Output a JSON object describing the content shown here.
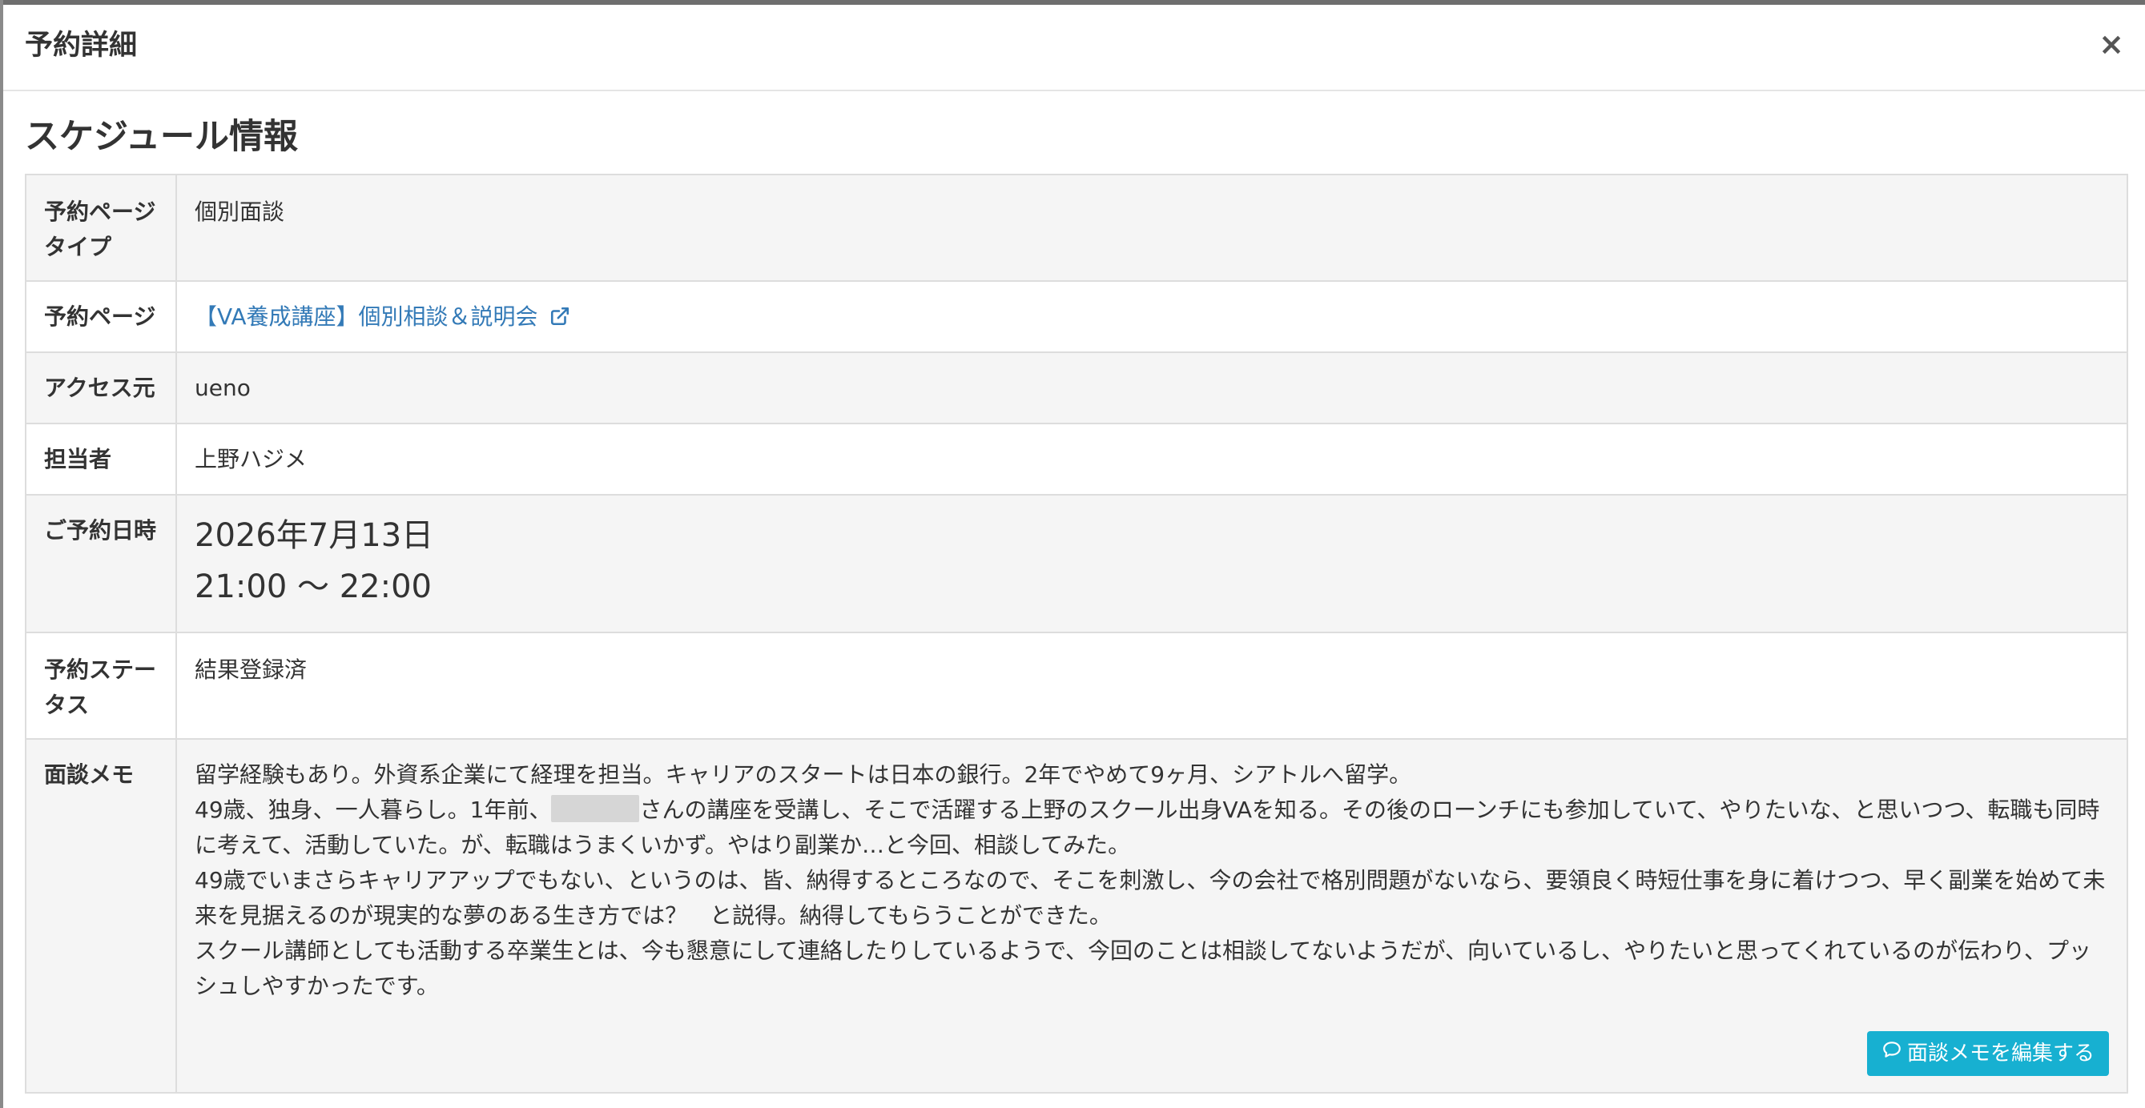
{
  "modal": {
    "title": "予約詳細",
    "close_label": "×"
  },
  "section_title": "スケジュール情報",
  "rows": {
    "page_type": {
      "label": "予約ページタイプ",
      "value": "個別面談"
    },
    "page": {
      "label": "予約ページ",
      "value": "【VA養成講座】個別相談＆説明会"
    },
    "access": {
      "label": "アクセス元",
      "value": "ueno"
    },
    "staff": {
      "label": "担当者",
      "value": "上野ハジメ"
    },
    "datetime": {
      "label": "ご予約日時",
      "date": "2026年7月13日",
      "time": "21:00 〜 22:00"
    },
    "status": {
      "label": "予約ステータス",
      "value": "結果登録済"
    },
    "memo": {
      "label": "面談メモ",
      "line1": "留学経験もあり。外資系企業にて経理を担当。キャリアのスタートは日本の銀行。2年でやめて9ヶ月、シアトルへ留学。",
      "line2_pre": "49歳、独身、一人暮らし。1年前、",
      "line2_post": "さんの講座を受講し、そこで活躍する上野のスクール出身VAを知る。その後のローンチにも参加していて、やりたいな、と思いつつ、転職も同時に考えて、活動していた。が、転職はうまくいかず。やはり副業か…と今回、相談してみた。",
      "line3": "49歳でいまさらキャリアアップでもない、というのは、皆、納得するところなので、そこを刺激し、今の会社で格別問題がないなら、要領良く時短仕事を身に着けつつ、早く副業を始めて未来を見据えるのが現実的な夢のある生き方では？　と説得。納得してもらうことができた。",
      "line4": "スクール講師としても活動する卒業生とは、今も懇意にして連絡したりしているようで、今回のことは相談してないようだが、向いているし、やりたいと思ってくれているのが伝わり、プッシュしやすかったです。",
      "edit_button": "面談メモを編集する"
    }
  },
  "icons": {
    "external_link": "external-link-icon",
    "comment": "comment-icon"
  },
  "colors": {
    "link": "#337ab7",
    "edit_button_bg": "#17b0d1",
    "odd_row_bg": "#f5f5f5"
  }
}
